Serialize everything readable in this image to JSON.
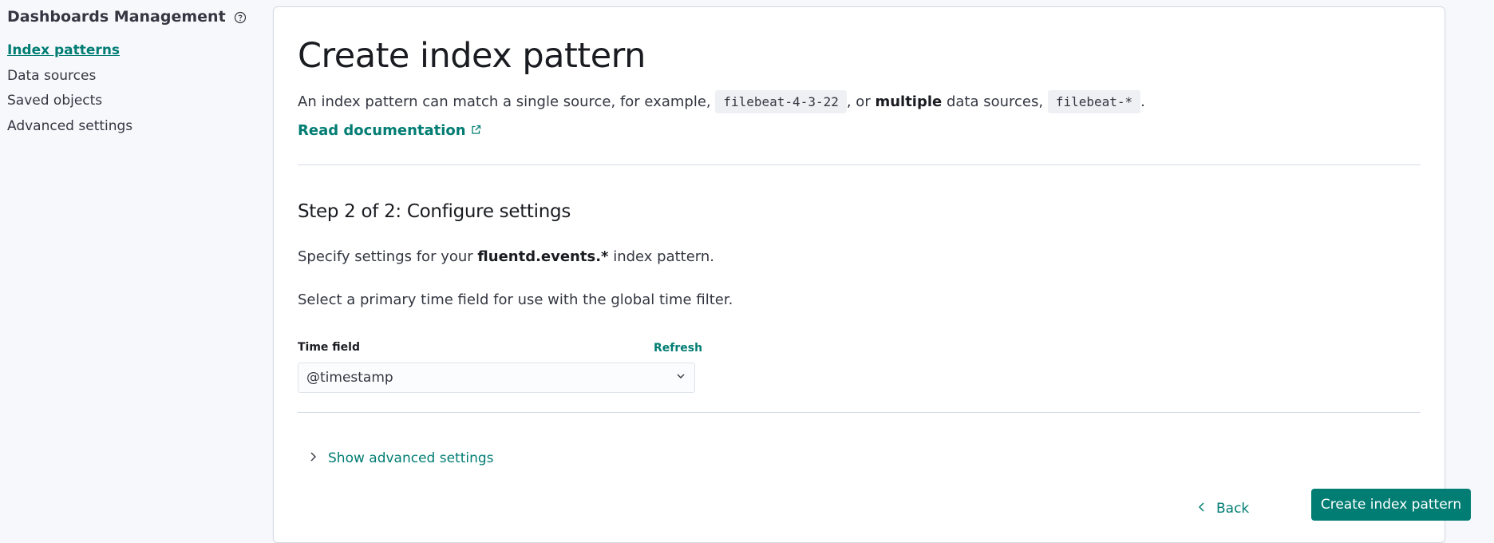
{
  "sidebar": {
    "title": "Dashboards Management",
    "items": [
      {
        "label": "Index patterns",
        "active": true
      },
      {
        "label": "Data sources"
      },
      {
        "label": "Saved objects"
      },
      {
        "label": "Advanced settings"
      }
    ]
  },
  "header": {
    "title": "Create index pattern",
    "intro": {
      "part1": "An index pattern can match a single source, for example,",
      "code1": "filebeat-4-3-22",
      "part2": ", or",
      "bold": "multiple",
      "part3": "data sources,",
      "code2": "filebeat-*",
      "part4": "."
    },
    "doc_link": "Read documentation"
  },
  "step": {
    "title": "Step 2 of 2: Configure settings",
    "specify_prefix": "Specify settings for your",
    "pattern_name": "fluentd.events.*",
    "specify_suffix": "index pattern.",
    "time_hint": "Select a primary time field for use with the global time filter."
  },
  "time_field": {
    "label": "Time field",
    "refresh": "Refresh",
    "value": "@timestamp"
  },
  "advanced": {
    "label": "Show advanced settings"
  },
  "footer": {
    "back": "Back",
    "create": "Create index pattern"
  },
  "colors": {
    "accent": "#017d73",
    "background": "#f7f8fc",
    "panel": "#ffffff"
  }
}
